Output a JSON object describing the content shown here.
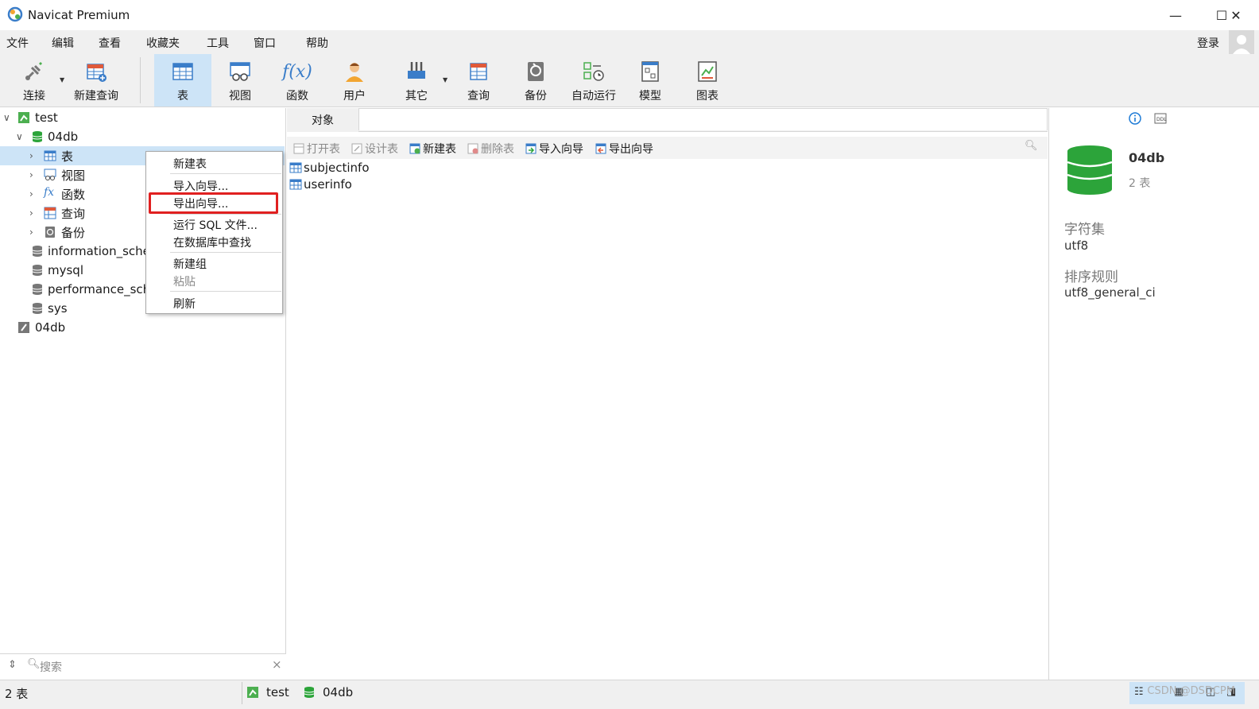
{
  "window": {
    "title": "Navicat Premium",
    "minimize": "—",
    "maximize": "☐",
    "close": "✕"
  },
  "menu": {
    "items": [
      "文件",
      "编辑",
      "查看",
      "收藏夹",
      "工具",
      "窗口",
      "帮助"
    ],
    "login": "登录"
  },
  "toolbar": {
    "connect": "连接",
    "new_query": "新建查询",
    "table": "表",
    "view": "视图",
    "function": "函数",
    "user": "用户",
    "other": "其它",
    "query": "查询",
    "backup": "备份",
    "auto_run": "自动运行",
    "model": "模型",
    "chart": "图表"
  },
  "tree": {
    "conn_test": "test",
    "db_04db": "04db",
    "tables": "表",
    "views": "视图",
    "functions": "函数",
    "queries": "查询",
    "backups": "备份",
    "db_info": "information_sche",
    "db_mysql": "mysql",
    "db_perf": "performance_sch",
    "db_sys": "sys",
    "conn_04db": "04db"
  },
  "context_menu": {
    "new_table": "新建表",
    "import_wizard": "导入向导...",
    "export_wizard": "导出向导...",
    "run_sql": "运行 SQL 文件...",
    "find_in_db": "在数据库中查找",
    "new_group": "新建组",
    "paste": "粘贴",
    "refresh": "刷新"
  },
  "left_search": {
    "placeholder": "搜索",
    "clear": "×"
  },
  "center": {
    "tab_objects": "对象",
    "obj_toolbar": {
      "open_table": "打开表",
      "design_table": "设计表",
      "new_table": "新建表",
      "delete_table": "删除表",
      "import_wizard": "导入向导",
      "export_wizard": "导出向导"
    },
    "tables": [
      "subjectinfo",
      "userinfo"
    ]
  },
  "info": {
    "db_name": "04db",
    "table_count": "2 表",
    "charset_label": "字符集",
    "charset_value": "utf8",
    "collation_label": "排序规则",
    "collation_value": "utf8_general_ci"
  },
  "status": {
    "count": "2 表",
    "connection": "test",
    "database": "04db",
    "watermark": "CSDN @DSDCPM"
  },
  "colors": {
    "accent": "#cde4f7",
    "db_green": "#2ca43a",
    "highlight_red": "#e02020",
    "table_blue": "#3a7dc9"
  }
}
